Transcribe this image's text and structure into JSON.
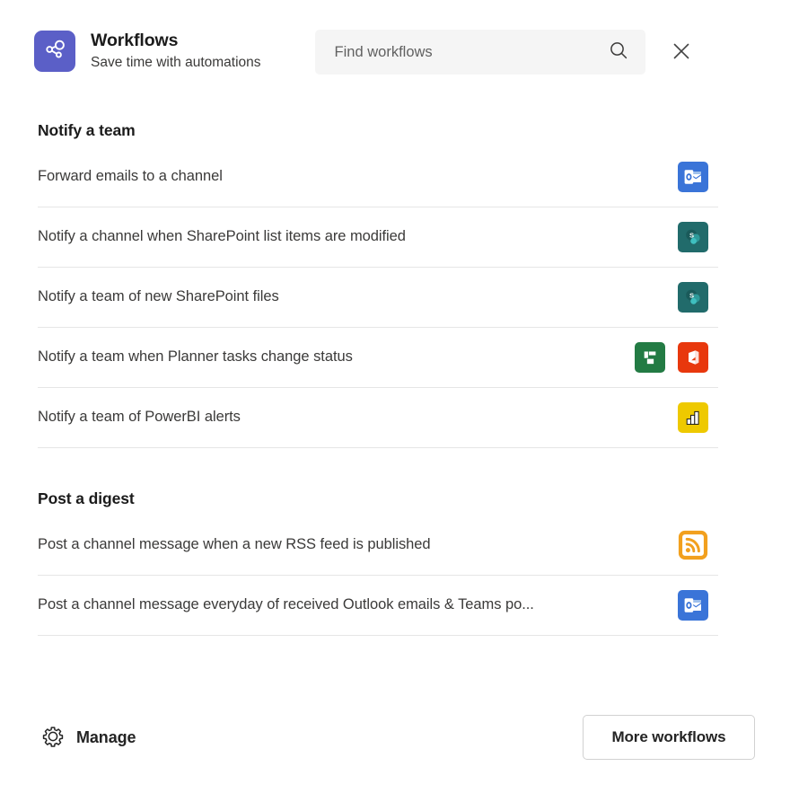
{
  "header": {
    "logo_icon": "share-nodes-icon",
    "logo_color": "#5b5fc7",
    "title": "Workflows",
    "subtitle": "Save time with automations",
    "close_icon": "close-icon"
  },
  "search": {
    "placeholder": "Find workflows",
    "value": "",
    "icon": "search-icon"
  },
  "sections": [
    {
      "title": "Notify a team",
      "items": [
        {
          "label": "Forward emails to a channel",
          "icons": [
            "outlook-icon"
          ]
        },
        {
          "label": "Notify a channel when SharePoint list items are modified",
          "icons": [
            "sharepoint-icon"
          ]
        },
        {
          "label": "Notify a team of new SharePoint files",
          "icons": [
            "sharepoint-icon"
          ]
        },
        {
          "label": "Notify a team when Planner tasks change status",
          "icons": [
            "planner-icon",
            "office-icon"
          ]
        },
        {
          "label": "Notify a team of PowerBI alerts",
          "icons": [
            "powerbi-icon"
          ]
        }
      ]
    },
    {
      "title": "Post a digest",
      "items": [
        {
          "label": "Post a channel message when a new RSS feed is published",
          "icons": [
            "rss-icon"
          ]
        },
        {
          "label": "Post a channel message everyday of received Outlook emails & Teams po...",
          "icons": [
            "outlook-icon"
          ]
        }
      ]
    }
  ],
  "footer": {
    "manage_label": "Manage",
    "manage_icon": "gear-icon",
    "more_label": "More workflows"
  },
  "colors": {
    "accent": "#5b5fc7",
    "outlook": "#3a74d8",
    "sharepoint": "#216b6b",
    "planner": "#237b44",
    "office": "#e8380d",
    "powerbi": "#eec900",
    "rss": "#f2a01e",
    "divider": "#e6e6e6",
    "search_bg": "#f5f5f5"
  }
}
